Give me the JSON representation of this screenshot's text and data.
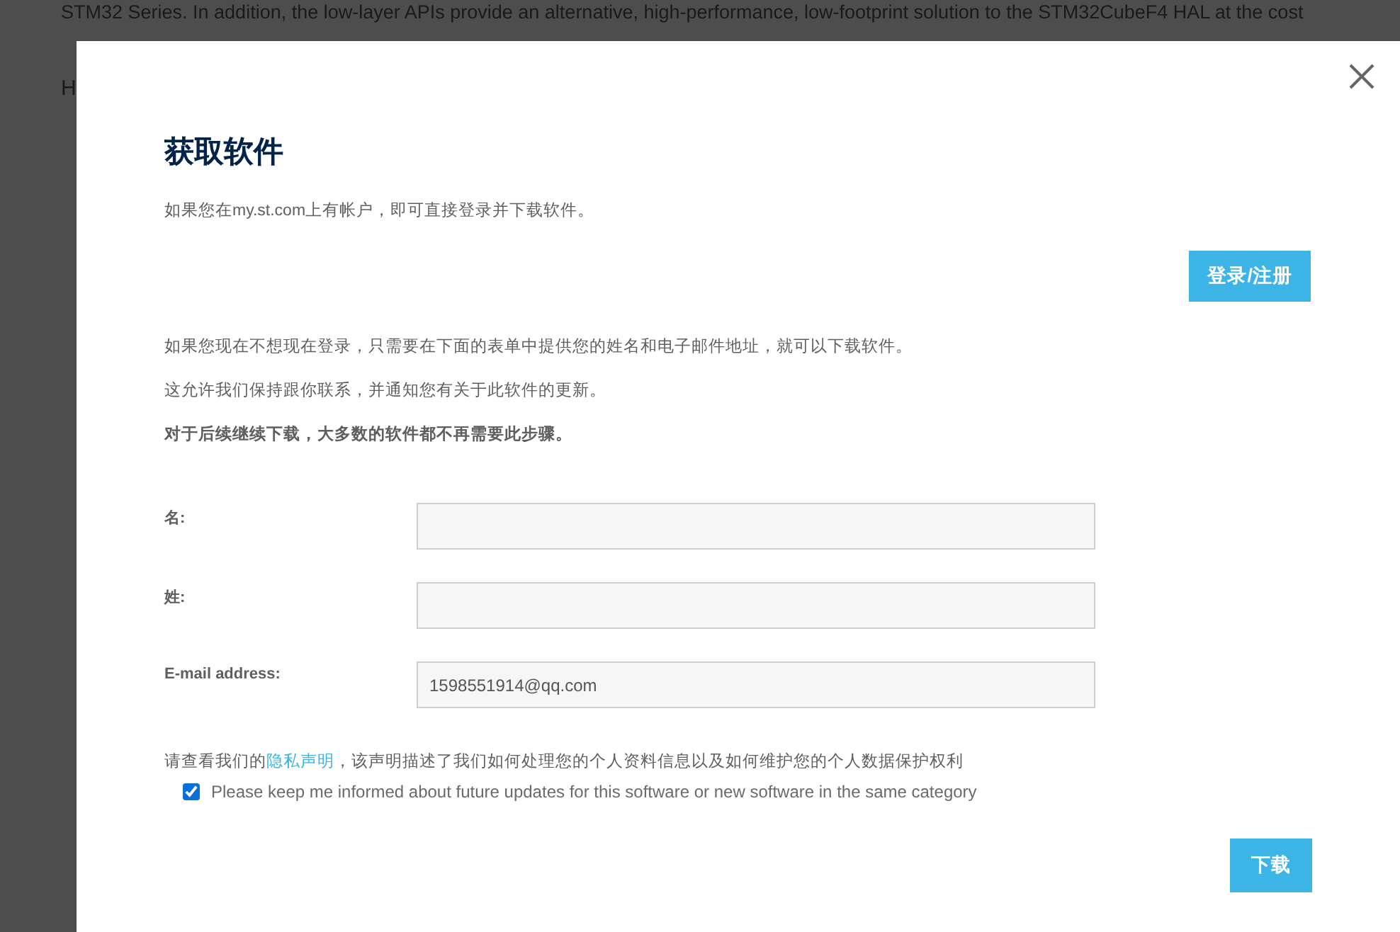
{
  "background_page": {
    "paragraph_lines": [
      "STM32 Series. In addition, the low-layer APIs provide an alternative, high-performance, low-footprint solution to the STM32CubeF4 HAL at the cost"
    ],
    "next_line": "H"
  },
  "dialog": {
    "title": "获取软件",
    "intro": "如果您在my.st.com上有帐户，即可直接登录并下载软件。",
    "login_button": "登录/注册",
    "notes": [
      {
        "text": "如果您现在不想现在登录，只需要在下面的表单中提供您的姓名和电子邮件地址，就可以下载软件。",
        "bold": false
      },
      {
        "text": "这允许我们保持跟你联系，并通知您有关于此软件的更新。",
        "bold": false
      },
      {
        "text": "对于后续继续下载，大多数的软件都不再需要此步骤。",
        "bold": true
      }
    ],
    "fields": [
      {
        "label": "名:"
      },
      {
        "label": "姓:"
      },
      {
        "label": "E-mail address:",
        "value": "1598551914@qq.com"
      }
    ],
    "privacy": {
      "before": "请查看我们的",
      "link": "隐私声明",
      "after": "，该声明描述了我们如何处理您的个人资料信息以及如何维护您的个人数据保护权利"
    },
    "subscribe": {
      "label": "Please keep me informed about future updates for this software or new software in the same category",
      "checked": true
    },
    "download_button": "下载"
  }
}
